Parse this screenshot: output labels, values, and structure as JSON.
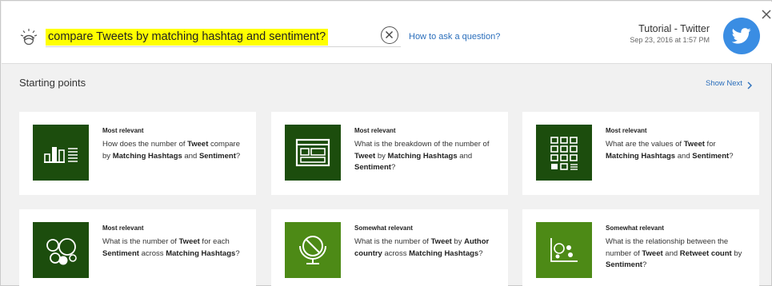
{
  "header": {
    "query": "compare Tweets by matching hashtag and sentiment?",
    "help_link": "How to ask a question?",
    "dataset_title": "Tutorial - Twitter",
    "dataset_date": "Sep 23, 2016 at 1:57 PM"
  },
  "section": {
    "title": "Starting points",
    "show_next": "Show Next"
  },
  "colors": {
    "dark_green": "#1c4d0d",
    "light_green": "#4d8a16",
    "twitter_blue": "#3a8de3",
    "link_blue": "#2a6ebb",
    "highlight": "#ffff00"
  },
  "cards": [
    {
      "relevance": "Most relevant",
      "icon": "bar-chart-icon",
      "parts": [
        {
          "t": "How does the number of ",
          "b": false
        },
        {
          "t": "Tweet",
          "b": true
        },
        {
          "t": " compare by ",
          "b": false
        },
        {
          "t": "Matching Hashtags",
          "b": true
        },
        {
          "t": " and ",
          "b": false
        },
        {
          "t": "Sentiment",
          "b": true
        },
        {
          "t": "?",
          "b": false
        }
      ]
    },
    {
      "relevance": "Most relevant",
      "icon": "dashboard-icon",
      "parts": [
        {
          "t": "What is the breakdown of the number of ",
          "b": false
        },
        {
          "t": "Tweet",
          "b": true
        },
        {
          "t": " by ",
          "b": false
        },
        {
          "t": "Matching Hashtags",
          "b": true
        },
        {
          "t": " and ",
          "b": false
        },
        {
          "t": "Sentiment",
          "b": true
        },
        {
          "t": "?",
          "b": false
        }
      ]
    },
    {
      "relevance": "Most relevant",
      "icon": "grid-table-icon",
      "parts": [
        {
          "t": "What are the values of ",
          "b": false
        },
        {
          "t": "Tweet",
          "b": true
        },
        {
          "t": " for ",
          "b": false
        },
        {
          "t": "Matching Hashtags",
          "b": true
        },
        {
          "t": " and ",
          "b": false
        },
        {
          "t": "Sentiment",
          "b": true
        },
        {
          "t": "?",
          "b": false
        }
      ]
    },
    {
      "relevance": "Most relevant",
      "icon": "bubble-chart-icon",
      "parts": [
        {
          "t": "What is the number of ",
          "b": false
        },
        {
          "t": "Tweet",
          "b": true
        },
        {
          "t": " for each ",
          "b": false
        },
        {
          "t": "Sentiment",
          "b": true
        },
        {
          "t": " across ",
          "b": false
        },
        {
          "t": "Matching Hashtags",
          "b": true
        },
        {
          "t": "?",
          "b": false
        }
      ]
    },
    {
      "relevance": "Somewhat relevant",
      "icon": "globe-icon",
      "parts": [
        {
          "t": "What is the number of ",
          "b": false
        },
        {
          "t": "Tweet",
          "b": true
        },
        {
          "t": " by ",
          "b": false
        },
        {
          "t": "Author country",
          "b": true
        },
        {
          "t": " across ",
          "b": false
        },
        {
          "t": "Matching Hashtags",
          "b": true
        },
        {
          "t": "?",
          "b": false
        }
      ]
    },
    {
      "relevance": "Somewhat relevant",
      "icon": "scatter-plot-icon",
      "parts": [
        {
          "t": "What is the relationship between the number of ",
          "b": false
        },
        {
          "t": "Tweet",
          "b": true
        },
        {
          "t": " and ",
          "b": false
        },
        {
          "t": "Retweet count",
          "b": true
        },
        {
          "t": " by ",
          "b": false
        },
        {
          "t": "Sentiment",
          "b": true
        },
        {
          "t": "?",
          "b": false
        }
      ]
    }
  ]
}
